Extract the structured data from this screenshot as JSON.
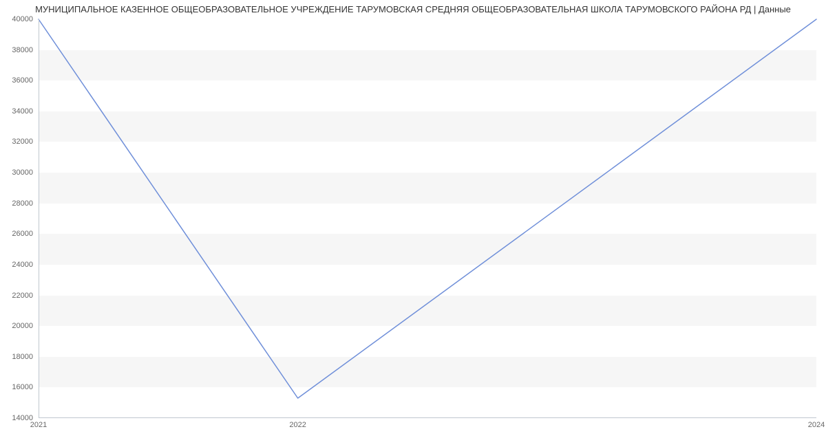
{
  "chart_data": {
    "type": "line",
    "title": "МУНИЦИПАЛЬНОЕ КАЗЕННОЕ ОБЩЕОБРАЗОВАТЕЛЬНОЕ УЧРЕЖДЕНИЕ ТАРУМОВСКАЯ СРЕДНЯЯ ОБЩЕОБРАЗОВАТЕЛЬНАЯ ШКОЛА ТАРУМОВСКОГО РАЙОНА РД | Данные",
    "x": [
      2021,
      2022,
      2024
    ],
    "values": [
      40000,
      15300,
      40000
    ],
    "xlabel": "",
    "ylabel": "",
    "ylim": [
      14000,
      40000
    ],
    "y_ticks": [
      14000,
      16000,
      18000,
      20000,
      22000,
      24000,
      26000,
      28000,
      30000,
      32000,
      34000,
      36000,
      38000,
      40000
    ],
    "x_ticks": [
      2021,
      2022,
      2024
    ],
    "line_color": "#6f8fd9",
    "band_color": "#f6f6f6"
  }
}
